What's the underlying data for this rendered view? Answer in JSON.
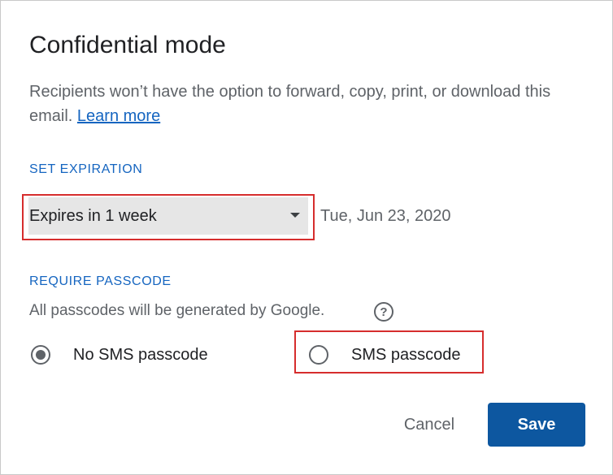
{
  "dialog": {
    "title": "Confidential mode",
    "description": "Recipients won’t have the option to forward, copy, print, or download this email.",
    "learn_more": "Learn more"
  },
  "expiration": {
    "section_label": "SET EXPIRATION",
    "selected": "Expires in 1 week",
    "date": "Tue, Jun 23, 2020"
  },
  "passcode": {
    "section_label": "REQUIRE PASSCODE",
    "note": "All passcodes will be generated by Google.",
    "options": [
      {
        "label": "No SMS passcode",
        "selected": true
      },
      {
        "label": "SMS passcode",
        "selected": false
      }
    ]
  },
  "actions": {
    "cancel_label": "Cancel",
    "save_label": "Save"
  },
  "colors": {
    "accent": "#1565c0",
    "save_button": "#0d57a0",
    "highlight": "#d62d2d"
  },
  "icons": {
    "help": "help-circle-icon",
    "select_arrow": "dropdown-arrow-icon"
  }
}
